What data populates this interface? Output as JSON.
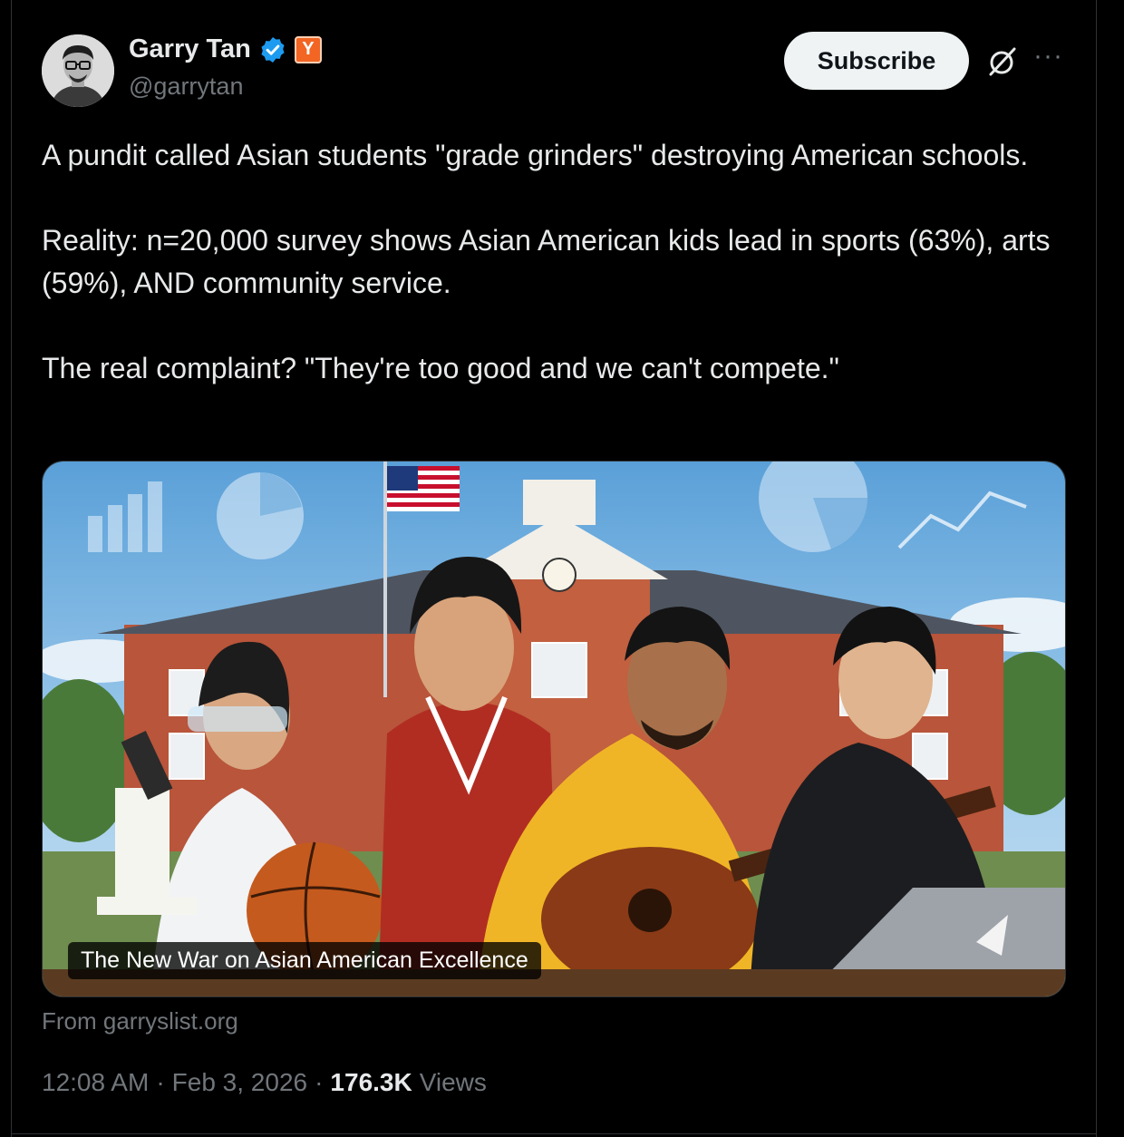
{
  "author": {
    "display_name": "Garry Tan",
    "handle": "@garrytan",
    "badge_letter": "Y"
  },
  "actions": {
    "subscribe_label": "Subscribe",
    "more_label": "···"
  },
  "tweet": {
    "paragraphs": [
      "A pundit called Asian students \"grade grinders\" destroying American schools.",
      "Reality: n=20,000 survey shows Asian American kids lead in sports (63%), arts (59%), AND community service.",
      "The real complaint? \"They're too good and we can't compete.\""
    ]
  },
  "card": {
    "title": "The New War on Asian American Excellence",
    "source": "From garryslist.org"
  },
  "meta": {
    "time": "12:08 AM",
    "separator": "·",
    "date": "Feb 3, 2026",
    "views_count": "176.3K",
    "views_label": "Views"
  },
  "colors": {
    "background": "#000000",
    "text": "#e7e9ea",
    "secondary": "#71767b",
    "verified": "#1d9bf0",
    "yc": "#f26522"
  }
}
